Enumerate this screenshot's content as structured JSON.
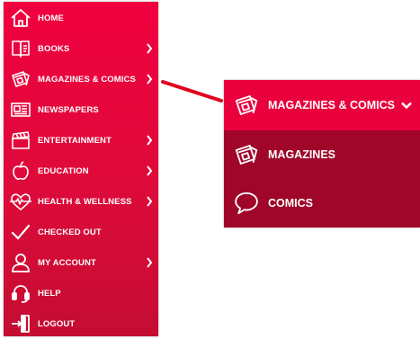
{
  "sidebar": {
    "items": [
      {
        "label": "HOME",
        "icon": "home-icon",
        "chevron": false
      },
      {
        "label": "BOOKS",
        "icon": "book-icon",
        "chevron": true
      },
      {
        "label": "MAGAZINES & COMICS",
        "icon": "magazine-icon",
        "chevron": true
      },
      {
        "label": "NEWSPAPERS",
        "icon": "newspaper-icon",
        "chevron": false
      },
      {
        "label": "ENTERTAINMENT",
        "icon": "clapperboard-icon",
        "chevron": true
      },
      {
        "label": "EDUCATION",
        "icon": "apple-icon",
        "chevron": true
      },
      {
        "label": "HEALTH & WELLNESS",
        "icon": "heartbeat-icon",
        "chevron": true
      },
      {
        "label": "CHECKED OUT",
        "icon": "checkmark-icon",
        "chevron": false
      },
      {
        "label": "MY ACCOUNT",
        "icon": "user-icon",
        "chevron": true
      },
      {
        "label": "HELP",
        "icon": "headset-icon",
        "chevron": false
      },
      {
        "label": "LOGOUT",
        "icon": "logout-door-icon",
        "chevron": false
      }
    ]
  },
  "submenu": {
    "header_label": "MAGAZINES & COMICS",
    "items": [
      {
        "label": "MAGAZINES",
        "icon": "magazine-icon"
      },
      {
        "label": "COMICS",
        "icon": "speech-bubble-icon"
      }
    ]
  },
  "colors": {
    "sidebar_top": "#f0003f",
    "sidebar_bottom": "#c40d33",
    "submenu_header": "#e9003c",
    "submenu_items": "#a0062a",
    "pointer_line": "#e0001b"
  }
}
